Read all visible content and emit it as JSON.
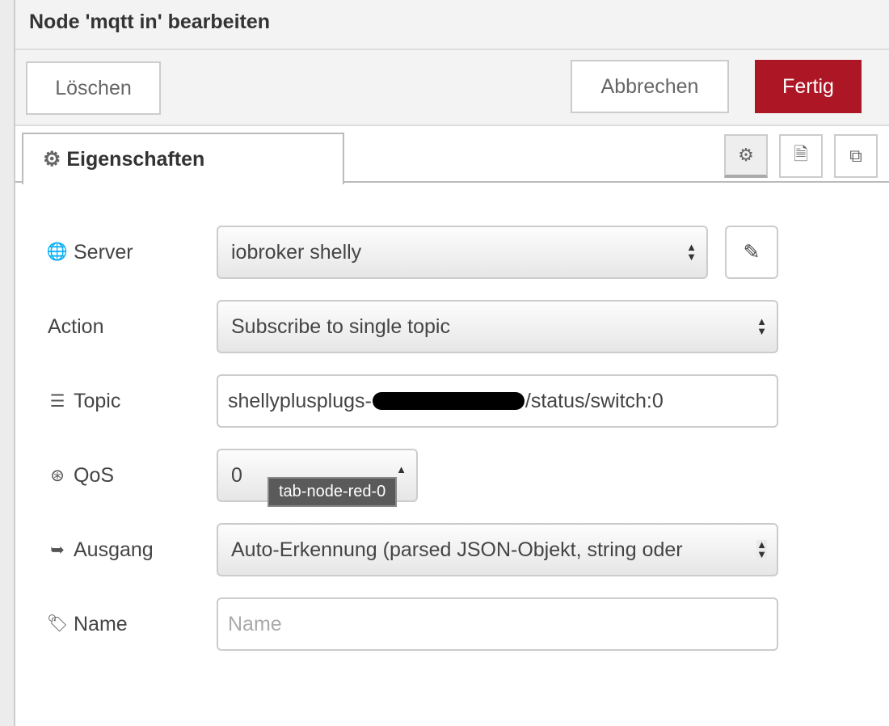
{
  "title": "Node 'mqtt in' bearbeiten",
  "toolbar": {
    "delete": "Löschen",
    "cancel": "Abbrechen",
    "done": "Fertig",
    "done_color": "#ad1625"
  },
  "tabs": {
    "properties": "Eigenschaften",
    "icons": [
      "gear-icon",
      "description-icon",
      "appearance-icon"
    ]
  },
  "form": {
    "server": {
      "label": "Server",
      "value": "iobroker shelly"
    },
    "action": {
      "label": "Action",
      "value": "Subscribe to single topic"
    },
    "topic": {
      "label": "Topic",
      "prefix": "shellyplusplugs-",
      "suffix": "/status/switch:0"
    },
    "qos": {
      "label": "QoS",
      "value": "0"
    },
    "output": {
      "label": "Ausgang",
      "value": "Auto-Erkennung (parsed JSON-Objekt, string oder"
    },
    "name": {
      "label": "Name",
      "placeholder": "Name",
      "value": ""
    }
  },
  "tooltip": "tab-node-red-0"
}
